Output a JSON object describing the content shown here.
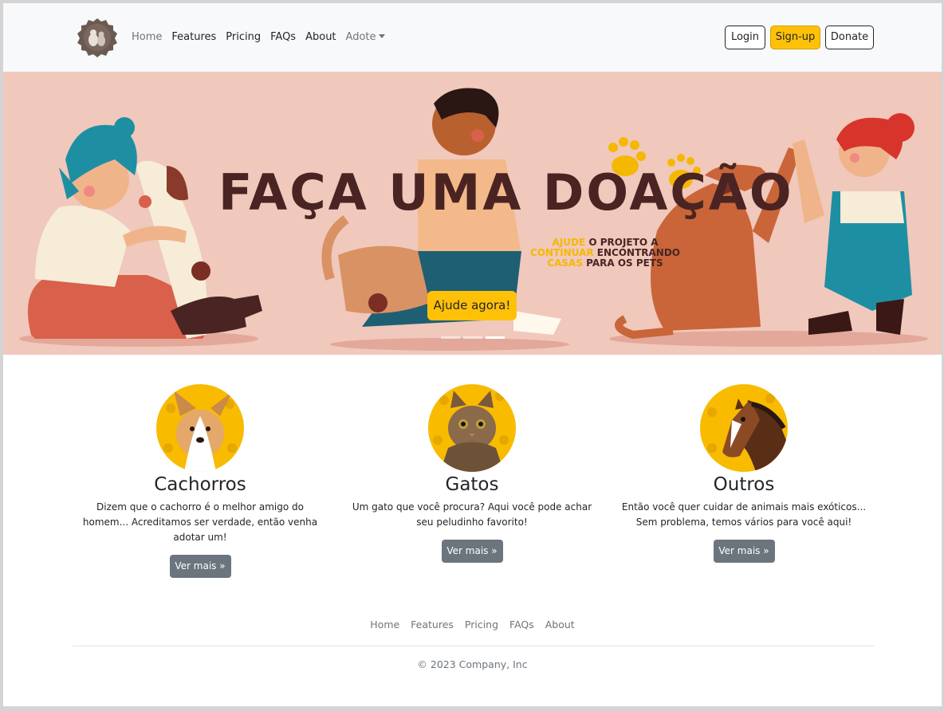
{
  "nav": {
    "links": [
      "Home",
      "Features",
      "Pricing",
      "FAQs",
      "About"
    ],
    "dropdown": "Adote",
    "buttons": {
      "login": "Login",
      "signup": "Sign-up",
      "donate": "Donate"
    }
  },
  "hero": {
    "title": "FAÇA UMA DOAÇÃO",
    "subtitle_words": {
      "w1": "AJUDE",
      "w2": " O PROJETO A",
      "w3": "CONTINUAR",
      "w4": " ENCONTRANDO",
      "w5": "CASAS",
      "w6": " PARA OS PETS"
    },
    "button": "Ajude agora!",
    "slides": 3,
    "active_slide": 3
  },
  "cards": [
    {
      "title": "Cachorros",
      "text": "Dizem que o cachorro é o melhor amigo do homem... Acreditamos ser verdade, então venha adotar um!",
      "button": "Ver mais »"
    },
    {
      "title": "Gatos",
      "text": "Um gato que você procura? Aqui você pode achar seu peludinho favorito!",
      "button": "Ver mais »"
    },
    {
      "title": "Outros",
      "text": "Então você quer cuidar de animais mais exóticos... Sem problema, temos vários para você aqui!",
      "button": "Ver mais »"
    }
  ],
  "footer": {
    "links": [
      "Home",
      "Features",
      "Pricing",
      "FAQs",
      "About"
    ],
    "copyright": "© 2023 Company, Inc"
  },
  "colors": {
    "accent": "#ffc107",
    "hero_bg": "#f0c8bc",
    "title": "#4a2422",
    "secondary": "#6c757d"
  }
}
